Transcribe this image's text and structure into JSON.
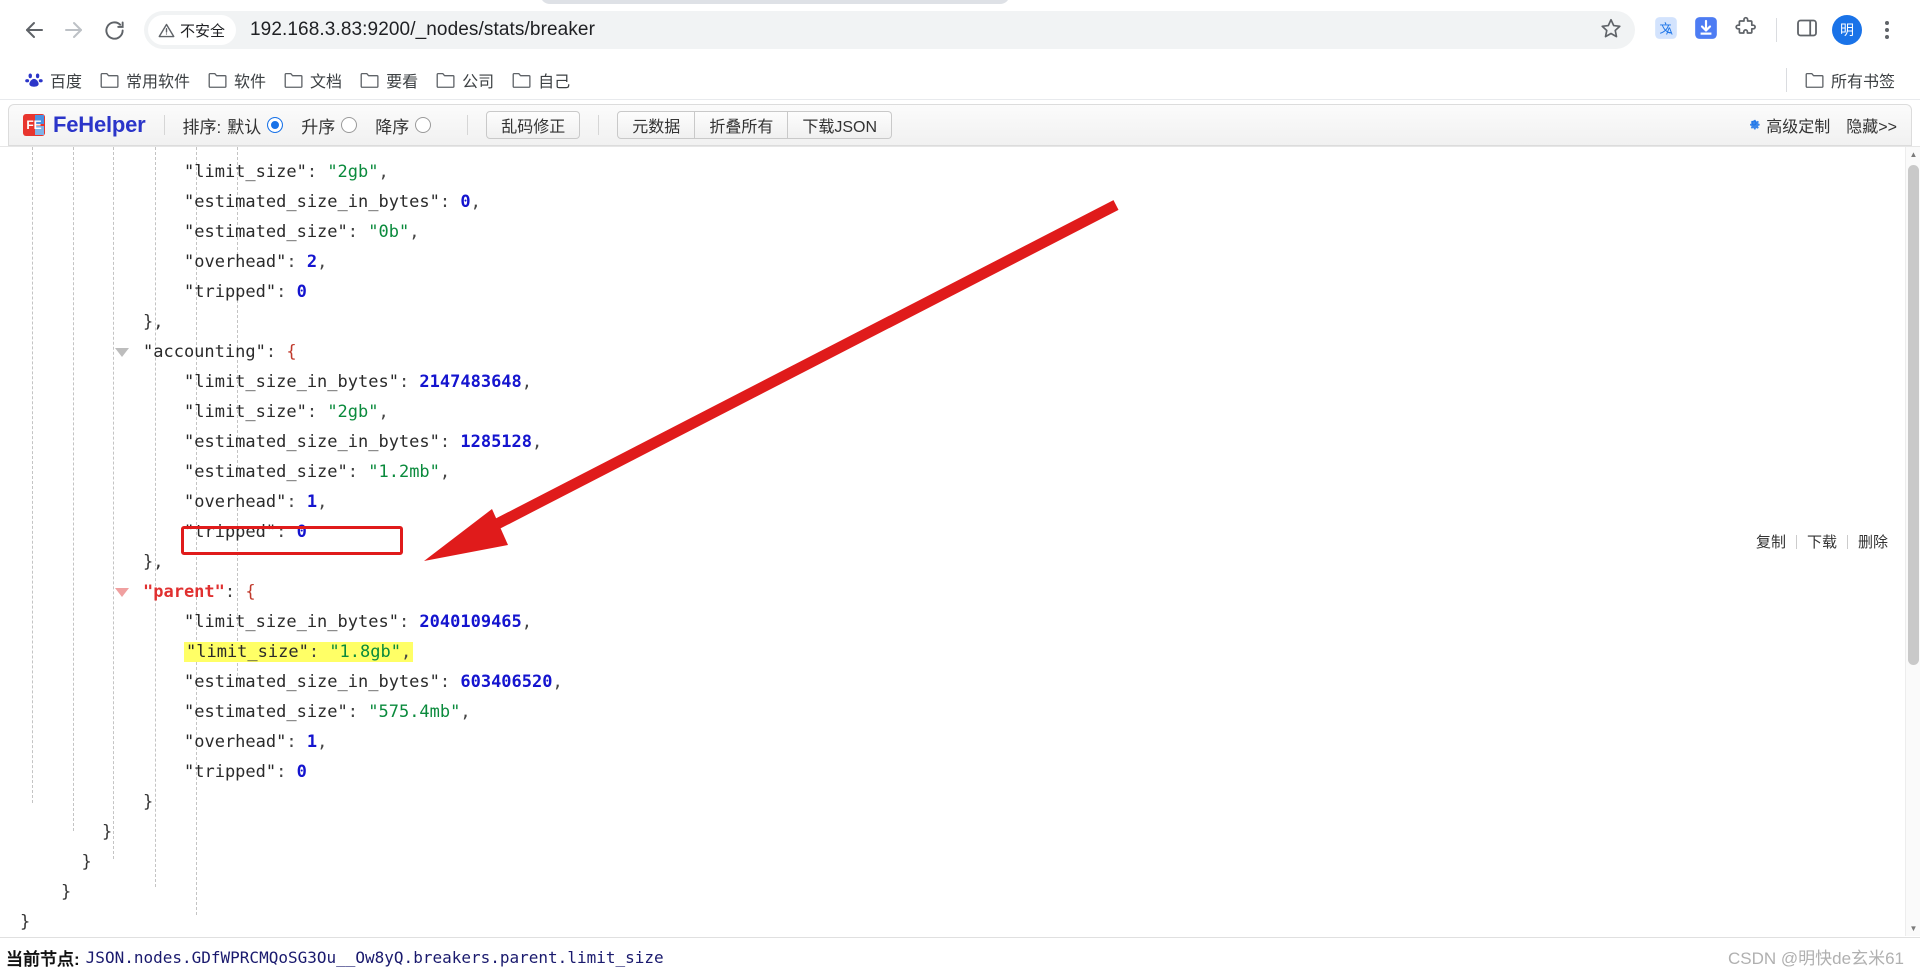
{
  "browser": {
    "back_icon": "arrow-left-icon",
    "forward_icon": "arrow-right-icon",
    "reload_icon": "reload-icon",
    "security_chip_label": "不安全",
    "security_icon": "warning-triangle-icon",
    "url": "192.168.3.83:9200/_nodes/stats/breaker",
    "star_icon": "star-icon",
    "translate_icon": "translate-icon",
    "download_icon": "download-icon",
    "extensions_icon": "extensions-puzzle-icon",
    "sidepanel_icon": "side-panel-icon",
    "avatar_label": "明",
    "menu_icon": "kebab-menu-icon"
  },
  "bookmarks": {
    "items": [
      {
        "label": "百度",
        "icon": "baidu-paw-icon"
      },
      {
        "label": "常用软件",
        "icon": "folder-icon"
      },
      {
        "label": "软件",
        "icon": "folder-icon"
      },
      {
        "label": "文档",
        "icon": "folder-icon"
      },
      {
        "label": "要看",
        "icon": "folder-icon"
      },
      {
        "label": "公司",
        "icon": "folder-icon"
      },
      {
        "label": "自己",
        "icon": "folder-icon"
      }
    ],
    "all_bookmarks": {
      "label": "所有书签",
      "icon": "folder-icon"
    }
  },
  "fehelper": {
    "brand": "FeHelper",
    "brand_mark": "FE",
    "sort_label": "排序:",
    "sort_options": [
      {
        "label": "默认",
        "selected": true
      },
      {
        "label": "升序",
        "selected": false
      },
      {
        "label": "降序",
        "selected": false
      }
    ],
    "fix_encoding_button": "乱码修正",
    "group_buttons": [
      "元数据",
      "折叠所有",
      "下载JSON"
    ],
    "advanced_label": "高级定制",
    "advanced_icon": "gear-icon",
    "hide_label": "隐藏>>"
  },
  "context_menu": {
    "items": [
      "复制",
      "下载",
      "删除"
    ]
  },
  "json_view": {
    "lines": [
      {
        "indent": 4,
        "caret": null,
        "key": "limit_size",
        "sep": ": ",
        "value": "\"2gb\"",
        "vtype": "str",
        "trail": ","
      },
      {
        "indent": 4,
        "caret": null,
        "key": "estimated_size_in_bytes",
        "sep": ": ",
        "value": "0",
        "vtype": "num",
        "trail": ","
      },
      {
        "indent": 4,
        "caret": null,
        "key": "estimated_size",
        "sep": ": ",
        "value": "\"0b\"",
        "vtype": "str",
        "trail": ","
      },
      {
        "indent": 4,
        "caret": null,
        "key": "overhead",
        "sep": ": ",
        "value": "2",
        "vtype": "num",
        "trail": ","
      },
      {
        "indent": 4,
        "caret": null,
        "key": "tripped",
        "sep": ": ",
        "value": "0",
        "vtype": "num",
        "trail": ""
      },
      {
        "indent": 3,
        "caret": null,
        "raw": "},"
      },
      {
        "indent": 3,
        "caret": "open",
        "key": "accounting",
        "sep": ": ",
        "value": "{",
        "vtype": "brace",
        "trail": ""
      },
      {
        "indent": 4,
        "caret": null,
        "key": "limit_size_in_bytes",
        "sep": ": ",
        "value": "2147483648",
        "vtype": "num",
        "trail": ","
      },
      {
        "indent": 4,
        "caret": null,
        "key": "limit_size",
        "sep": ": ",
        "value": "\"2gb\"",
        "vtype": "str",
        "trail": ","
      },
      {
        "indent": 4,
        "caret": null,
        "key": "estimated_size_in_bytes",
        "sep": ": ",
        "value": "1285128",
        "vtype": "num",
        "trail": ","
      },
      {
        "indent": 4,
        "caret": null,
        "key": "estimated_size",
        "sep": ": ",
        "value": "\"1.2mb\"",
        "vtype": "str",
        "trail": ","
      },
      {
        "indent": 4,
        "caret": null,
        "key": "overhead",
        "sep": ": ",
        "value": "1",
        "vtype": "num",
        "trail": ","
      },
      {
        "indent": 4,
        "caret": null,
        "key": "tripped",
        "sep": ": ",
        "value": "0",
        "vtype": "num",
        "trail": ""
      },
      {
        "indent": 3,
        "caret": null,
        "raw": "},"
      },
      {
        "indent": 3,
        "caret": "open-pink",
        "key": "parent",
        "keyred": true,
        "sep": ": ",
        "value": "{",
        "vtype": "brace",
        "trail": ""
      },
      {
        "indent": 4,
        "caret": null,
        "key": "limit_size_in_bytes",
        "sep": ": ",
        "value": "2040109465",
        "vtype": "num",
        "trail": ","
      },
      {
        "indent": 4,
        "caret": null,
        "key": "limit_size",
        "sep": ": ",
        "value": "\"1.8gb\"",
        "vtype": "str",
        "trail": ",",
        "highlight": true
      },
      {
        "indent": 4,
        "caret": null,
        "key": "estimated_size_in_bytes",
        "sep": ": ",
        "value": "603406520",
        "vtype": "num",
        "trail": ","
      },
      {
        "indent": 4,
        "caret": null,
        "key": "estimated_size",
        "sep": ": ",
        "value": "\"575.4mb\"",
        "vtype": "str",
        "trail": ","
      },
      {
        "indent": 4,
        "caret": null,
        "key": "overhead",
        "sep": ": ",
        "value": "1",
        "vtype": "num",
        "trail": ","
      },
      {
        "indent": 4,
        "caret": null,
        "key": "tripped",
        "sep": ": ",
        "value": "0",
        "vtype": "num",
        "trail": ""
      },
      {
        "indent": 3,
        "caret": null,
        "raw": "}"
      },
      {
        "indent": 2,
        "caret": null,
        "raw": "}"
      },
      {
        "indent": 1.5,
        "caret": null,
        "raw": "}"
      },
      {
        "indent": 1,
        "caret": null,
        "raw": "}"
      },
      {
        "indent": 0,
        "caret": null,
        "raw": "}"
      }
    ]
  },
  "statusbar": {
    "label": "当前节点:",
    "path": "JSON.nodes.GDfWPRCMQoSG3Ou__Ow8yQ.breakers.parent.limit_size"
  },
  "watermark": "CSDN @明快de玄米61",
  "colors": {
    "accent": "#1a73e8",
    "brand": "#2b35c9",
    "highlight": "#ffff66",
    "annotation": "#e01b1b",
    "string": "#0a8a3c",
    "number": "#1414cf",
    "key_red": "#e03030"
  }
}
